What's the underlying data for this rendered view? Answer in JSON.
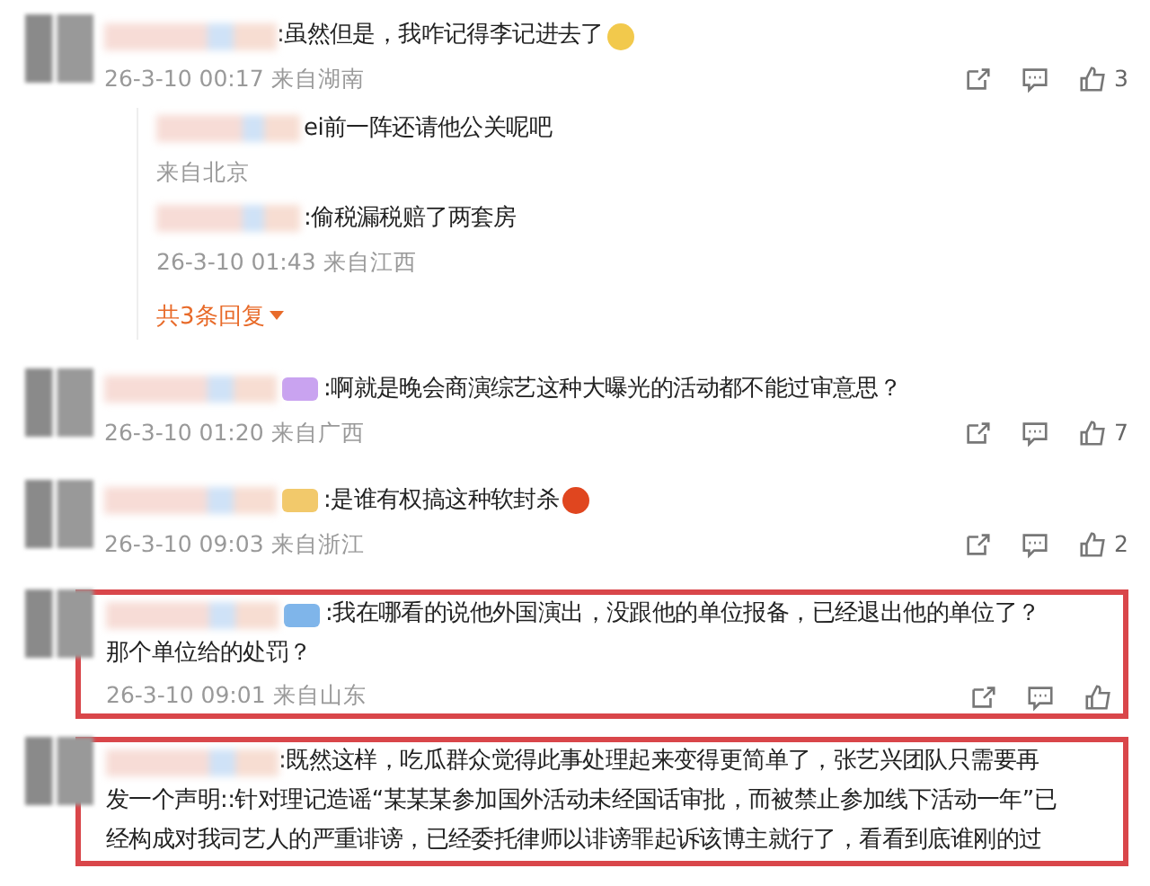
{
  "comments": [
    {
      "lines": [
        ":虽然但是，我咋记得李记进去了"
      ],
      "emoji": {
        "color": "#f2c94c"
      },
      "time": "26-3-10 00:17",
      "location": "来自湖南",
      "likes": "3",
      "highlighted": false,
      "replies": [
        {
          "text": "ei前一阵还请他公关呢吧",
          "location": "来自北京"
        },
        {
          "text": ":偷税漏税赔了两套房",
          "time": "26-3-10 01:43",
          "location": "来自江西"
        }
      ],
      "more_replies": "共3条回复"
    },
    {
      "lines": [
        ":啊就是晚会商演综艺这种大曝光的活动都不能过审意思？"
      ],
      "badge": {
        "color": "#c9a3f0"
      },
      "time": "26-3-10 01:20",
      "location": "来自广西",
      "likes": "7",
      "highlighted": false
    },
    {
      "lines": [
        ":是谁有权搞这种软封杀"
      ],
      "emoji": {
        "color": "#e0461f"
      },
      "badge": {
        "color": "#f2c96b"
      },
      "time": "26-3-10 09:03",
      "location": "来自浙江",
      "likes": "2",
      "highlighted": false
    },
    {
      "lines": [
        ":我在哪看的说他外国演出，没跟他的单位报备，已经退出他的单位了？",
        "那个单位给的处罚？"
      ],
      "badge": {
        "color": "#7fb5ea"
      },
      "time": "26-3-10 09:01",
      "location": "来自山东",
      "highlighted": true
    },
    {
      "lines": [
        ":既然这样，吃瓜群众觉得此事处理起来变得更简单了，张艺兴团队只需要再",
        "发一个声明::针对理记造谣“某某某参加国外活动未经国话审批，而被禁止参加线下活动一年”已",
        "经构成对我司艺人的严重诽谤，已经委托律师以诽谤罪起诉该博主就行了，看看到底谁刚的过"
      ],
      "highlighted": true
    }
  ]
}
